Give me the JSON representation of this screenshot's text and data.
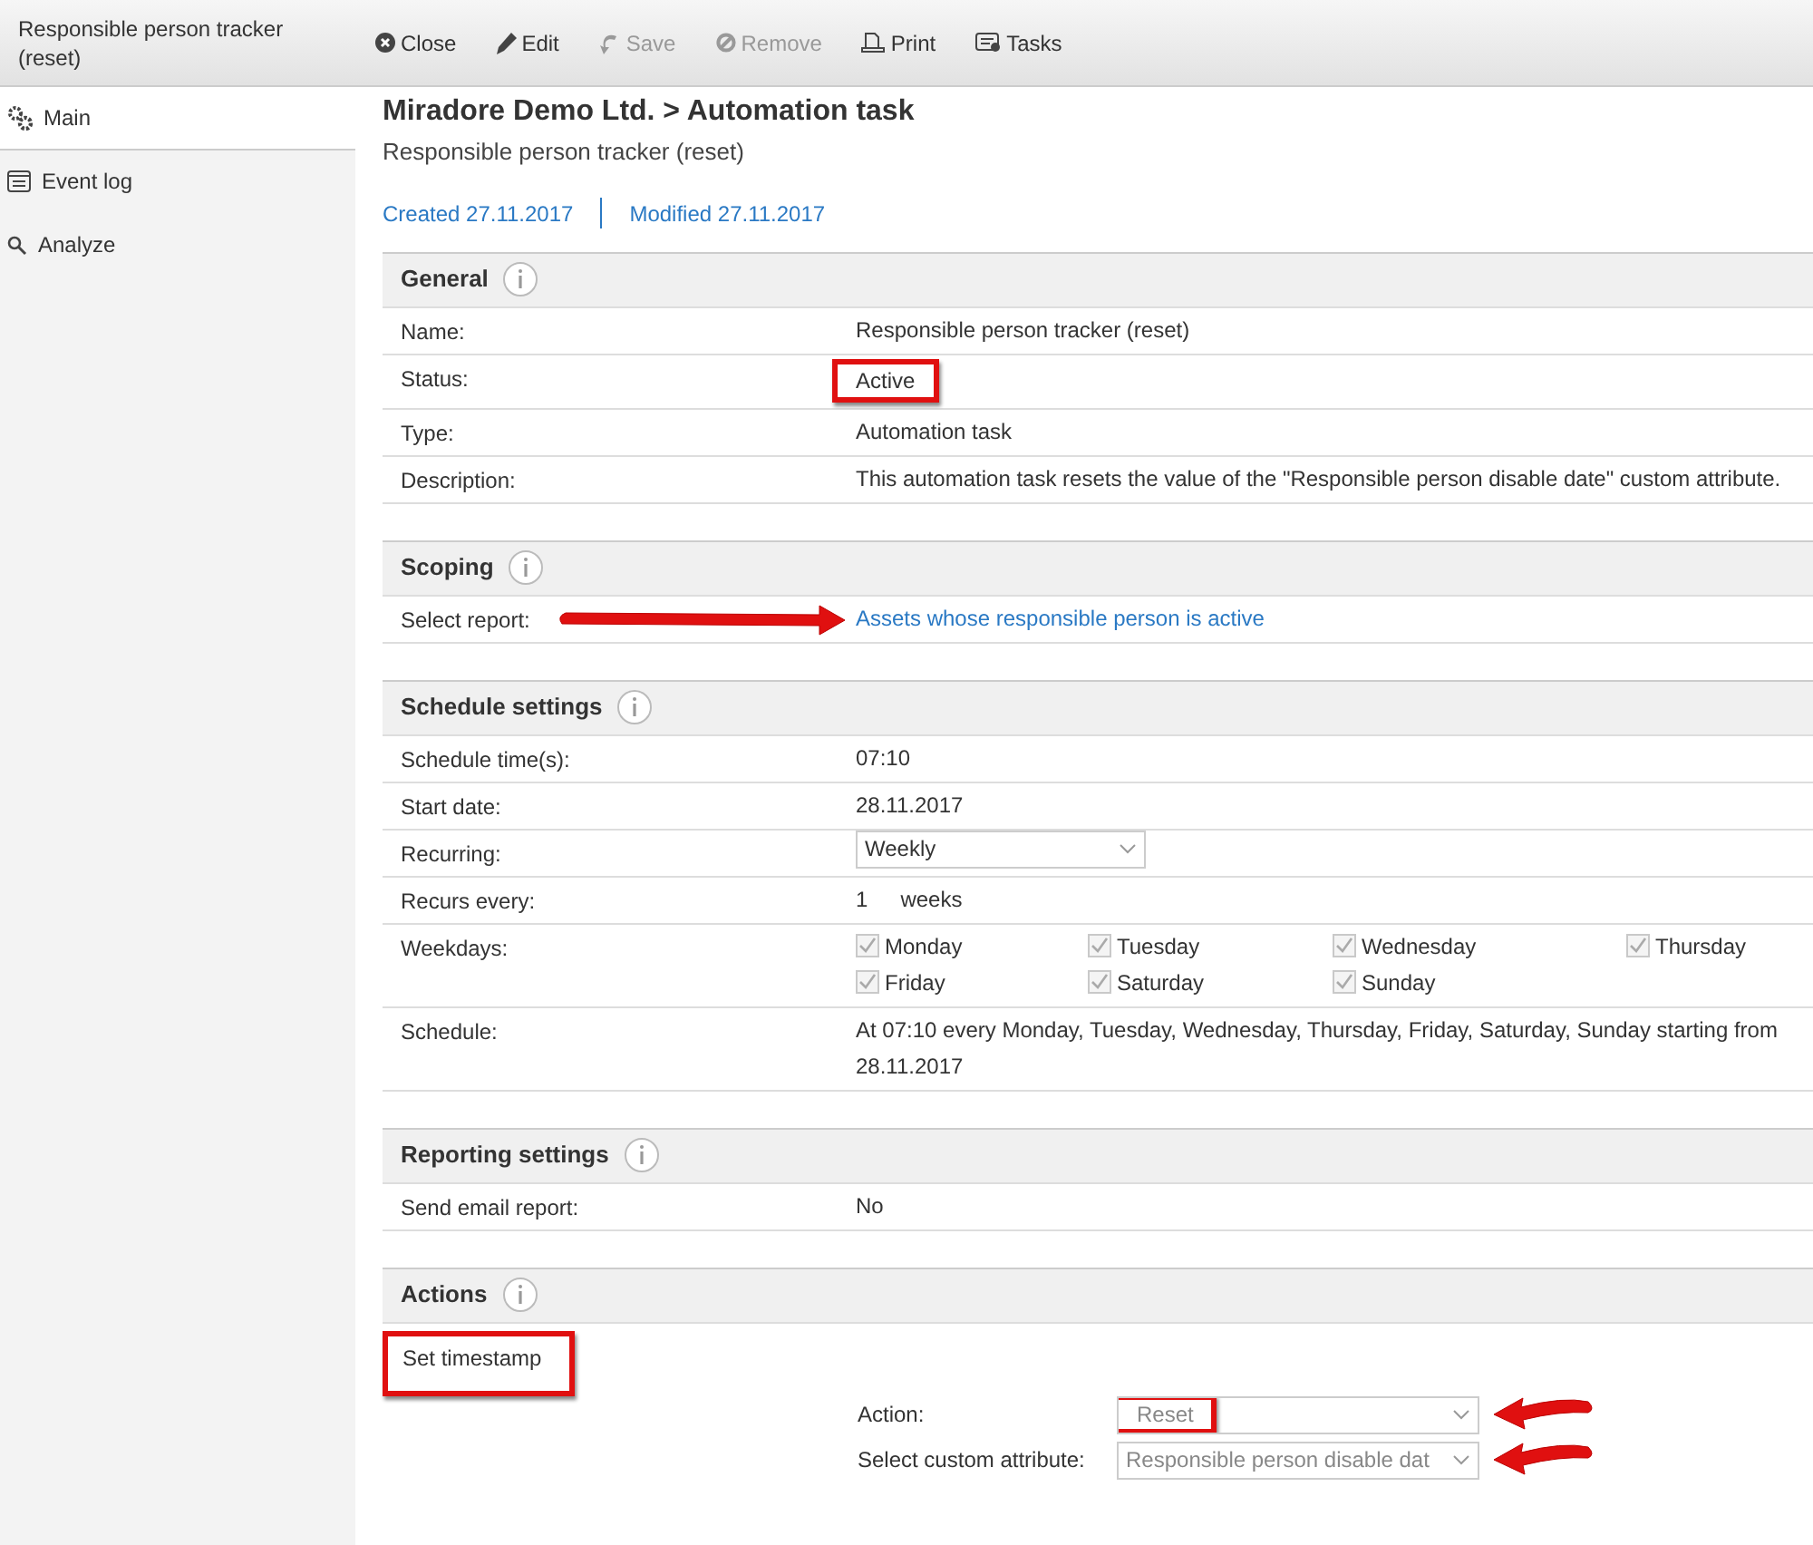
{
  "window": {
    "title": "Responsible person tracker (reset)"
  },
  "toolbar": [
    {
      "label": "Close",
      "disabled": false
    },
    {
      "label": "Edit",
      "disabled": false
    },
    {
      "label": "Save",
      "disabled": true
    },
    {
      "label": "Remove",
      "disabled": true
    },
    {
      "label": "Print",
      "disabled": false
    },
    {
      "label": "Tasks",
      "disabled": false
    }
  ],
  "sidebar": {
    "items": [
      {
        "label": "Main",
        "selected": true
      },
      {
        "label": "Event log",
        "selected": false
      },
      {
        "label": "Analyze",
        "selected": false
      }
    ]
  },
  "header": {
    "breadcrumb": "Miradore Demo Ltd. > Automation task",
    "subtitle": "Responsible person tracker (reset)",
    "created": "Created 27.11.2017",
    "modified": "Modified 27.11.2017"
  },
  "sections": [
    {
      "title": "General",
      "rows": [
        {
          "kind": "text",
          "label": "Name:",
          "value": "Responsible person tracker (reset)"
        },
        {
          "kind": "text",
          "label": "Status:",
          "value": "Active",
          "highlighted": true
        },
        {
          "kind": "text",
          "label": "Type:",
          "value": "Automation task"
        },
        {
          "kind": "text",
          "label": "Description:",
          "value": "This automation task resets the value of the \"Responsible person disable date\" custom attribute."
        }
      ]
    },
    {
      "title": "Scoping",
      "rows": [
        {
          "kind": "link",
          "label": "Select report:",
          "value": "Assets whose responsible person is active",
          "arrow": true
        }
      ]
    },
    {
      "title": "Schedule settings",
      "rows": [
        {
          "kind": "text",
          "label": "Schedule time(s):",
          "value": "07:10"
        },
        {
          "kind": "text",
          "label": "Start date:",
          "value": "28.11.2017"
        },
        {
          "kind": "select",
          "label": "Recurring:",
          "value": "Weekly"
        },
        {
          "kind": "recurs",
          "label": "Recurs every:",
          "value": "1",
          "unit": "weeks"
        },
        {
          "kind": "weekdays",
          "label": "Weekdays:",
          "days": [
            {
              "label": "Monday",
              "checked": true
            },
            {
              "label": "Tuesday",
              "checked": true
            },
            {
              "label": "Wednesday",
              "checked": true
            },
            {
              "label": "Thursday",
              "checked": true
            },
            {
              "label": "Friday",
              "checked": true
            },
            {
              "label": "Saturday",
              "checked": true
            },
            {
              "label": "Sunday",
              "checked": true
            }
          ]
        },
        {
          "kind": "text",
          "label": "Schedule:",
          "value": "At 07:10 every Monday, Tuesday, Wednesday, Thursday, Friday, Saturday, Sunday starting from 28.11.2017"
        }
      ]
    },
    {
      "title": "Reporting settings",
      "rows": [
        {
          "kind": "text",
          "label": "Send email report:",
          "value": "No"
        }
      ]
    },
    {
      "title": "Actions",
      "kind": "actions",
      "action_title": {
        "text": "Set timestamp",
        "highlighted": true
      },
      "fields": [
        {
          "label": "Action:",
          "value": "Reset",
          "highlighted": true,
          "arrow": true
        },
        {
          "label": "Select custom attribute:",
          "value": "Responsible person disable dat",
          "highlighted": false,
          "arrow": true
        }
      ]
    }
  ]
}
